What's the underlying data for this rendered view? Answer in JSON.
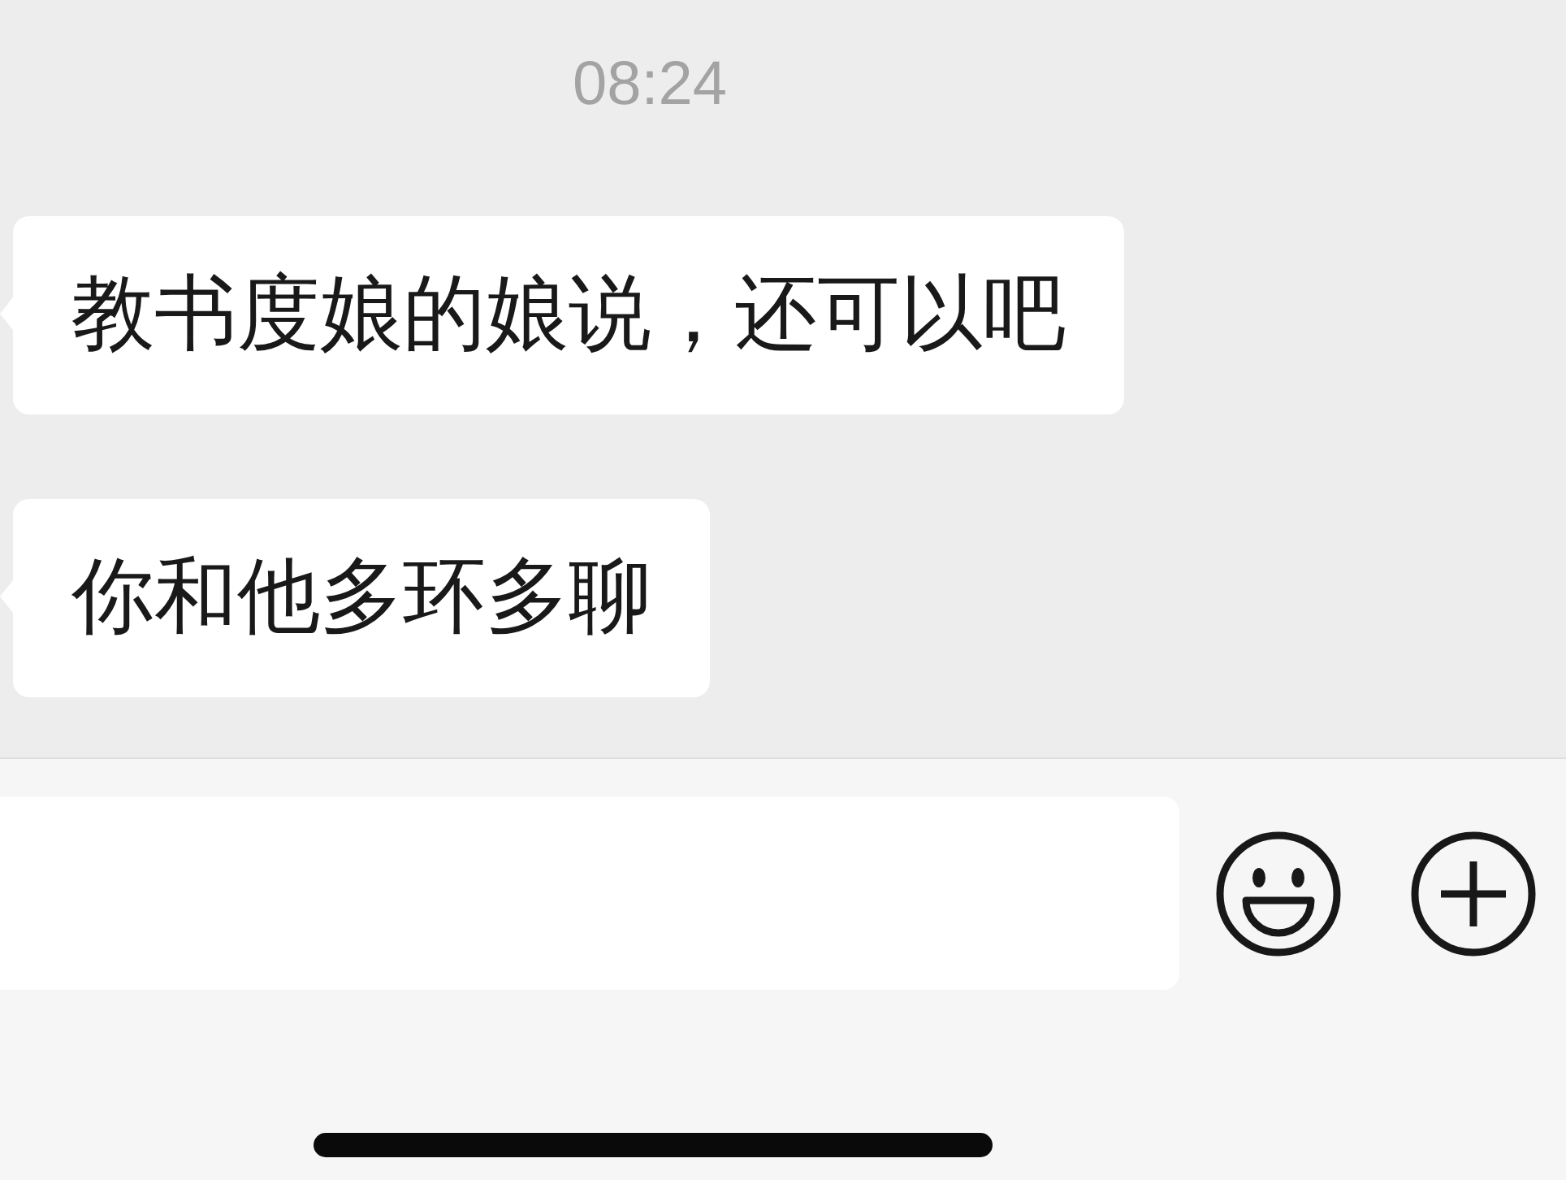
{
  "time": "08:24",
  "messages": [
    {
      "text": "教书度娘的娘说，还可以吧"
    },
    {
      "text": "你和他多环多聊"
    }
  ],
  "composer": {
    "buttons": [
      {
        "kind": "emoji"
      },
      {
        "kind": "add"
      }
    ]
  }
}
